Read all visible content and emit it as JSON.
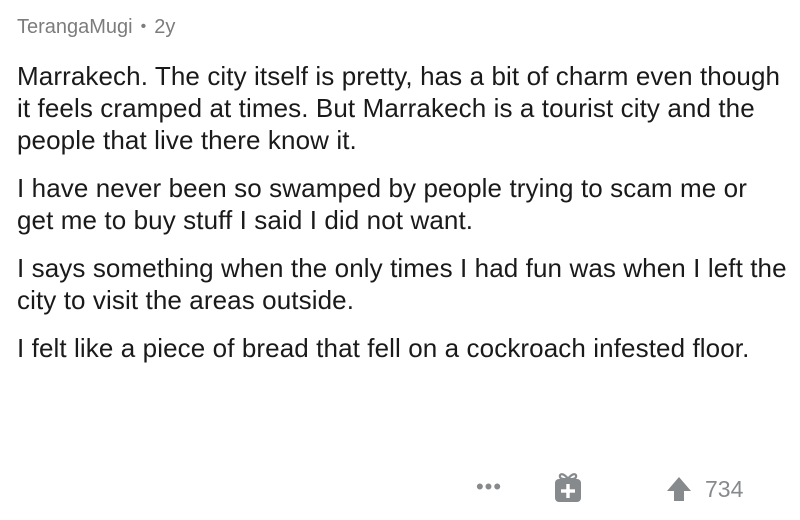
{
  "comment": {
    "author": "TerangaMugi",
    "separator": "•",
    "age": "2y",
    "paragraphs": [
      "Marrakech. The city itself is pretty, has a bit of charm even though it feels cramped at times. But Marrakech is a tourist city and the people that live there know it.",
      "I have never been so swamped by people trying to scam me or get me to buy stuff I said I did not want.",
      "I says something when the only times I had fun was when I left the city to visit the areas outside.",
      "I felt like a piece of bread that fell on a cockroach infested floor."
    ]
  },
  "actions": {
    "more_label": "•••",
    "gift_icon": "gift-icon",
    "upvote_icon": "upvote-arrow-icon",
    "score": "734"
  },
  "colors": {
    "text": "#1a1a1b",
    "muted": "#7c7c7c",
    "icon": "#878a8c"
  }
}
